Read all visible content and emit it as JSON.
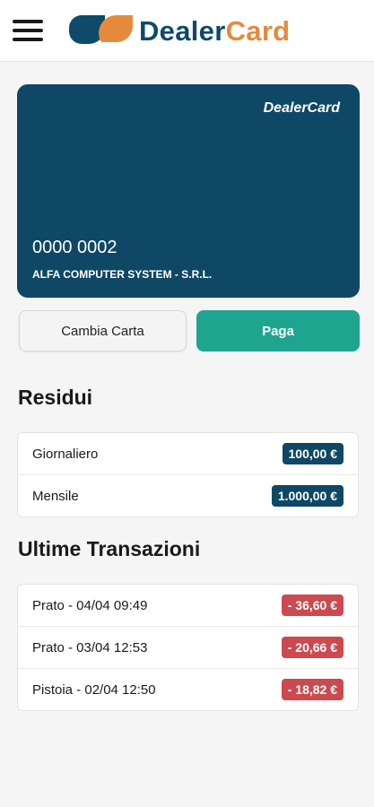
{
  "header": {
    "brand_part1": "Dealer",
    "brand_part2": "Card",
    "menu_icon": "hamburger-menu-icon",
    "logo_colors": {
      "primary": "#0e4a6a",
      "accent": "#e58a3c"
    }
  },
  "card": {
    "brand": "DealerCard",
    "number": "0000 0002",
    "holder": "ALFA COMPUTER SYSTEM - S.R.L.",
    "color": "#0e4865"
  },
  "actions": {
    "change_card": "Cambia Carta",
    "pay": "Paga",
    "pay_color": "#1fa490"
  },
  "residui": {
    "title": "Residui",
    "items": [
      {
        "label": "Giornaliero",
        "value": "100,00 €"
      },
      {
        "label": "Mensile",
        "value": "1.000,00 €"
      }
    ]
  },
  "transactions": {
    "title": "Ultime Transazioni",
    "items": [
      {
        "label": "Prato - 04/04 09:49",
        "amount": "- 36,60 €"
      },
      {
        "label": "Prato - 03/04 12:53",
        "amount": "- 20,66 €"
      },
      {
        "label": "Pistoia - 02/04 12:50",
        "amount": "- 18,82 €"
      }
    ]
  }
}
